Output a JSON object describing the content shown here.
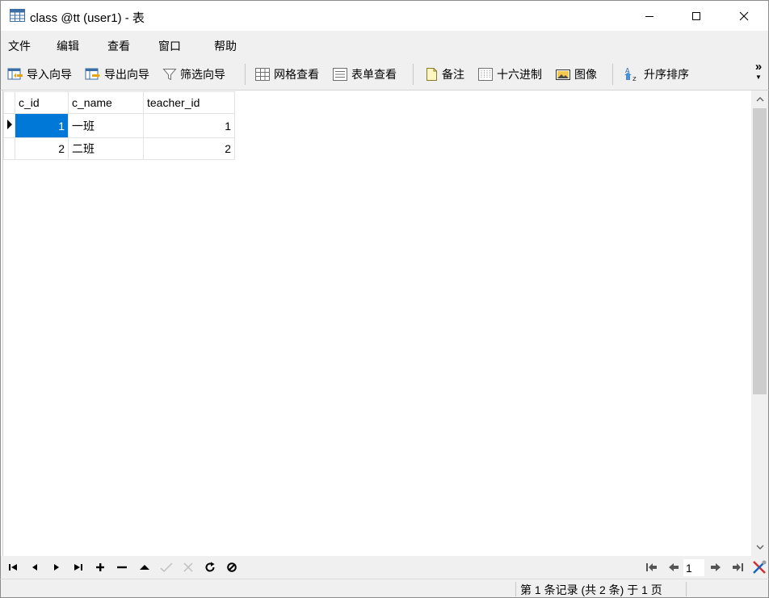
{
  "window": {
    "title": "class @tt (user1) - 表"
  },
  "menu": [
    "文件",
    "编辑",
    "查看",
    "窗口",
    "帮助"
  ],
  "toolbar": {
    "import_wizard": "导入向导",
    "export_wizard": "导出向导",
    "filter_wizard": "筛选向导",
    "grid_view": "网格查看",
    "form_view": "表单查看",
    "memo": "备注",
    "hex": "十六进制",
    "image": "图像",
    "sort_asc": "升序排序",
    "more": "»"
  },
  "grid": {
    "columns": [
      "c_id",
      "c_name",
      "teacher_id"
    ],
    "rows": [
      [
        "1",
        "一班",
        "1"
      ],
      [
        "2",
        "二班",
        "2"
      ]
    ]
  },
  "navigation": {
    "page": "1"
  },
  "status": {
    "record_info": "第 1 条记录 (共 2 条) 于 1 页"
  },
  "colors": {
    "selection": "#0078d7",
    "header_selected": "#cce8ff",
    "chrome": "#f0f0f0"
  }
}
